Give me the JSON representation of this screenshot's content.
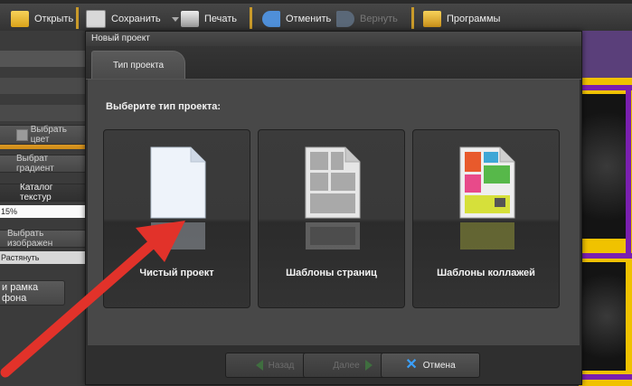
{
  "toolbar": {
    "open_label": "Открыть",
    "save_label": "Сохранить",
    "print_label": "Печать",
    "undo_label": "Отменить",
    "redo_label": "Вернуть",
    "programs_label": "Программы"
  },
  "left_panel": {
    "choose_color": "Выбрать цвет",
    "choose_gradient": "Выбрат градиент",
    "texture_catalog": "Каталог текстур",
    "percent_value": "15%",
    "choose_image": "Выбрать изображен",
    "stretch_value": "Растянуть",
    "frame_button": "и рамка фона"
  },
  "dialog": {
    "title": "Новый проект",
    "tab_label": "Тип проекта",
    "heading": "Выберите тип проекта:",
    "options": [
      {
        "label": "Чистый проект",
        "icon": "blank-page-icon"
      },
      {
        "label": "Шаблоны страниц",
        "icon": "page-template-icon"
      },
      {
        "label": "Шаблоны коллажей",
        "icon": "collage-template-icon"
      }
    ],
    "back_label": "Назад",
    "next_label": "Далее",
    "cancel_label": "Отмена"
  },
  "colors": {
    "accent_orange": "#e8a830",
    "annotation_red": "#e2322a",
    "cancel_blue": "#3aa0ff"
  }
}
